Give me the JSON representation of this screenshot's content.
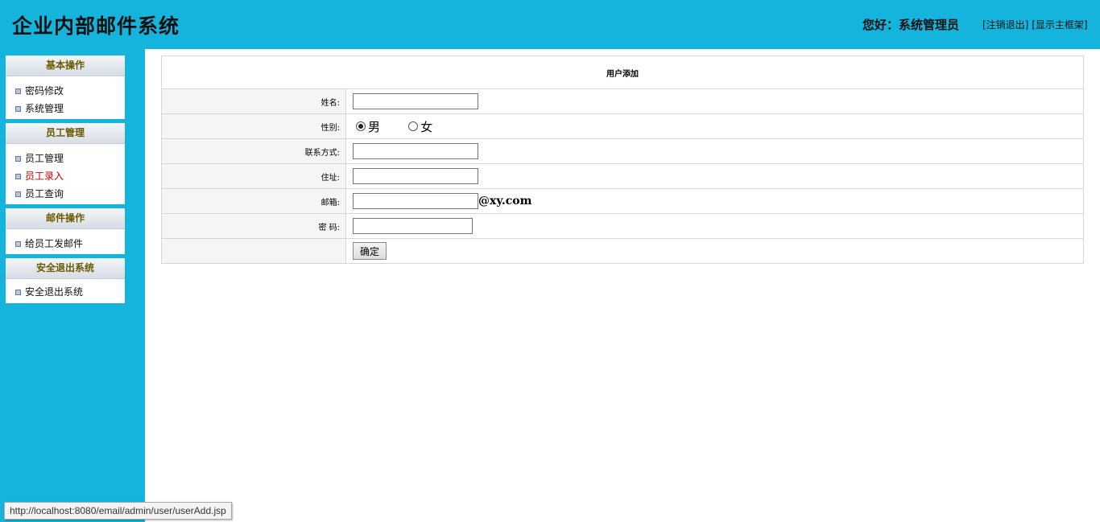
{
  "header": {
    "title": "企业内部邮件系统",
    "greeting": "您好：系统管理员",
    "links": [
      "[注销退出]",
      "[显示主框架]"
    ]
  },
  "sidebar": {
    "groups": [
      {
        "title": "基本操作",
        "items": [
          "密码修改",
          "系统管理"
        ]
      },
      {
        "title": "员工管理",
        "items": [
          "员工管理",
          "员工录入",
          "员工查询"
        ]
      },
      {
        "title": "邮件操作",
        "items": [
          "给员工发邮件"
        ]
      },
      {
        "title": "安全退出系统",
        "items": [
          "安全退出系统"
        ]
      }
    ],
    "active_item": "员工录入"
  },
  "form": {
    "title": "用户添加",
    "labels": {
      "name": "姓名:",
      "gender": "性别:",
      "contact": "联系方式:",
      "address": "住址:",
      "email": "邮箱:",
      "password": "密 码:"
    },
    "gender_options": [
      "男",
      "女"
    ],
    "gender_selected": "男",
    "email_suffix": "@xy.com",
    "submit_label": "确定"
  },
  "status_bar": "http://localhost:8080/email/admin/user/userAdd.jsp",
  "colors": {
    "accent": "#14b4dc",
    "menu_head_text": "#6b5a00",
    "active_item": "#c00000"
  }
}
